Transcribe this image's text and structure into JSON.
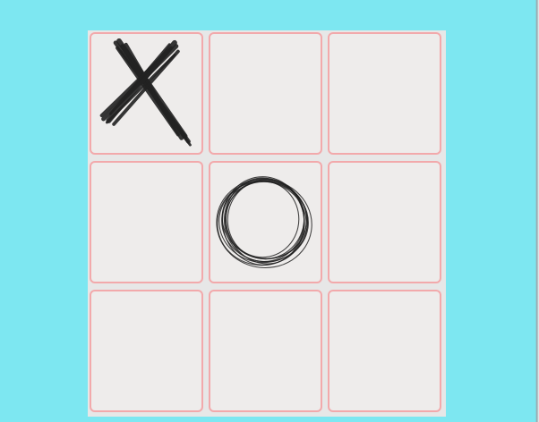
{
  "game": {
    "type": "tic-tac-toe",
    "board": [
      "X",
      "",
      "",
      "",
      "O",
      "",
      "",
      "",
      ""
    ]
  },
  "colors": {
    "background": "#7de7f1",
    "cell_fill": "#eeeceb",
    "cell_border": "#f2a9ab",
    "mark_ink": "#222222"
  }
}
